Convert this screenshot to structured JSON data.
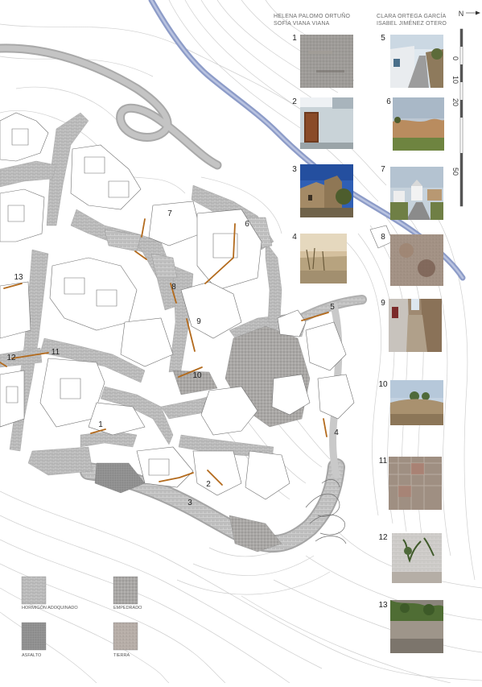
{
  "authors": {
    "left": [
      "HELENA PALOMO ORTUÑO",
      "SOFÍA VIANA VIANA"
    ],
    "right": [
      "CLARA ORTEGA GARCÍA",
      "ISABEL JIMÉNEZ OTERO"
    ]
  },
  "north": {
    "label": "N"
  },
  "scale": {
    "ticks": [
      "0",
      "10",
      "20",
      "50"
    ]
  },
  "photos": [
    {
      "number": "1",
      "subject": "stone-wall"
    },
    {
      "number": "2",
      "subject": "blue-facade-door"
    },
    {
      "number": "3",
      "subject": "stone-house-sky"
    },
    {
      "number": "4",
      "subject": "dry-stone-wall"
    },
    {
      "number": "5",
      "subject": "village-street"
    },
    {
      "number": "6",
      "subject": "field-edge"
    },
    {
      "number": "7",
      "subject": "road-to-church"
    },
    {
      "number": "8",
      "subject": "rock-texture"
    },
    {
      "number": "9",
      "subject": "narrow-lane"
    },
    {
      "number": "10",
      "subject": "rubble-mound"
    },
    {
      "number": "11",
      "subject": "wall-grid"
    },
    {
      "number": "12",
      "subject": "wall-plant"
    },
    {
      "number": "13",
      "subject": "earth-bank"
    }
  ],
  "sites": [
    {
      "number": "1"
    },
    {
      "number": "2"
    },
    {
      "number": "3"
    },
    {
      "number": "4"
    },
    {
      "number": "5"
    },
    {
      "number": "6"
    },
    {
      "number": "7"
    },
    {
      "number": "8"
    },
    {
      "number": "9"
    },
    {
      "number": "10"
    },
    {
      "number": "11"
    },
    {
      "number": "12"
    },
    {
      "number": "13"
    }
  ],
  "legend": [
    {
      "label": "HORMIGÓN ADOQUINADO",
      "swatch": "#9a9a9a"
    },
    {
      "label": "EMPEDRADO",
      "swatch": "#a7a4a2"
    },
    {
      "label": "ASFALTO",
      "swatch": "#8c8c8c"
    },
    {
      "label": "TIERRA",
      "swatch": "#b5aca6"
    }
  ],
  "colors": {
    "river": "#8d9cc8",
    "contour": "#c8c8c8",
    "road": "#b7b7b7",
    "paved": "#a9a9a9",
    "building": "#ffffff",
    "wall_marker": "#b36a1c"
  }
}
